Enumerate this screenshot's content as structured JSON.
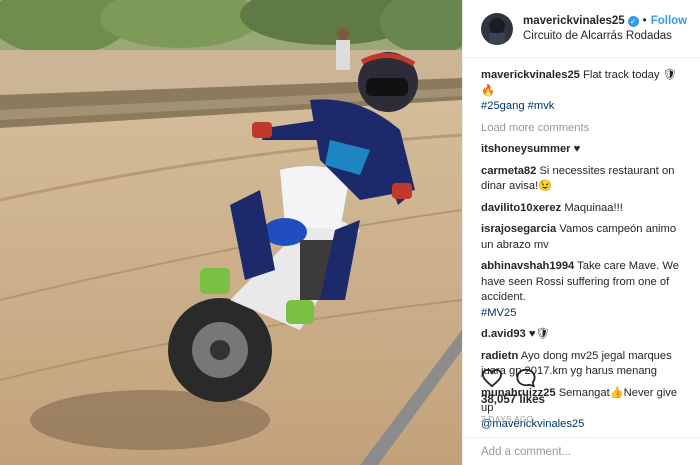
{
  "post": {
    "username": "maverickvinales25",
    "follow_label": "Follow",
    "separator": "•",
    "location": "Circuito de Alcarrás Rodadas",
    "caption": {
      "user": "maverickvinales25",
      "text": " Flat track today",
      "emojis": "🛡🔥",
      "hashtags": "#25gang #mvk"
    },
    "load_more": "Load more comments",
    "comments": [
      {
        "user": "itshoneysummer",
        "text": " ♥"
      },
      {
        "user": "carmeta82",
        "text": " Si necessites restaurant on dinar avisa!",
        "emoji": "😉"
      },
      {
        "user": "davilito10xerez",
        "text": " Maquinaa!!!"
      },
      {
        "user": "israjosegarcia",
        "text": " Vamos campeón animo un abrazo mv"
      },
      {
        "user": "abhinavshah1994",
        "text": " Take care Mave. We have seen Rossi suffering from one of accident.",
        "tag": "#MV25"
      },
      {
        "user": "d.avid93",
        "text": " ♥🛡"
      },
      {
        "user": "radietn",
        "text": " Ayo dong mv25 jegal marques juara gp 2017.km yg harus menang"
      },
      {
        "user": "munahruizz25",
        "text": " Semangat👍Never give up",
        "mention": "@maverickvinales25"
      }
    ],
    "likes": "38,057 likes",
    "time": "2 DAYS AGO",
    "add_comment_placeholder": "Add a comment..."
  },
  "icons": {
    "like": "heart-icon",
    "comment": "comment-bubble-icon",
    "verified": "verified-badge-icon"
  },
  "colors": {
    "accent": "#3897f0",
    "link": "#003569",
    "muted": "#999999"
  }
}
